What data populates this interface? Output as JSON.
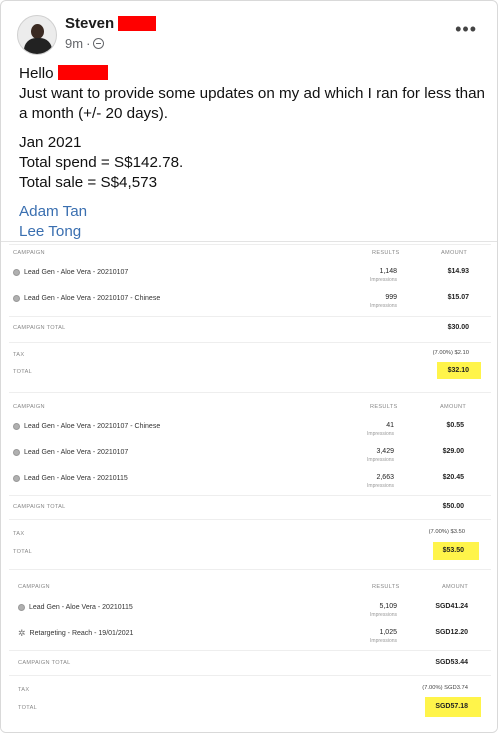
{
  "post": {
    "author": "Steven",
    "time": "9m",
    "visibility_icon": "globe-icon",
    "more_icon": "more-options-icon",
    "more_label": "•••",
    "greeting": "Hello",
    "body_line1": "Just want to provide some updates on my ad which I ran for less than a month (+/- 20 days).",
    "period": "Jan 2021",
    "total_spend": "Total spend = S$142.78.",
    "total_sale": "Total sale = S$4,573",
    "mentions": [
      "Adam Tan",
      "Lee Tong"
    ]
  },
  "screenshot": {
    "tables": [
      {
        "headers": {
          "campaign": "CAMPAIGN",
          "results": "RESULTS",
          "amount": "AMOUNT"
        },
        "rows": [
          {
            "icon": "dot",
            "name": "Lead Gen - Aloe Vera - 20210107",
            "results": "1,148",
            "results_sub": "Impressions",
            "amount": "$14.93"
          },
          {
            "icon": "dot",
            "name": "Lead Gen - Aloe Vera - 20210107 - Chinese",
            "results": "999",
            "results_sub": "Impressions",
            "amount": "$15.07"
          }
        ],
        "campaign_total_label": "CAMPAIGN TOTAL",
        "campaign_total": "$30.00",
        "tax_label": "TAX",
        "tax": "(7.00%) $2.10",
        "total_label": "TOTAL",
        "total": "$32.10"
      },
      {
        "headers": {
          "campaign": "CAMPAIGN",
          "results": "RESULTS",
          "amount": "AMOUNT"
        },
        "rows": [
          {
            "icon": "dot",
            "name": "Lead Gen - Aloe Vera - 20210107 - Chinese",
            "results": "41",
            "results_sub": "Impressions",
            "amount": "$0.55"
          },
          {
            "icon": "dot",
            "name": "Lead Gen - Aloe Vera - 20210107",
            "results": "3,429",
            "results_sub": "Impressions",
            "amount": "$29.00"
          },
          {
            "icon": "dot",
            "name": "Lead Gen - Aloe Vera - 20210115",
            "results": "2,663",
            "results_sub": "Impressions",
            "amount": "$20.45"
          }
        ],
        "campaign_total_label": "CAMPAIGN TOTAL",
        "campaign_total": "$50.00",
        "tax_label": "TAX",
        "tax": "(7.00%) $3.50",
        "total_label": "TOTAL",
        "total": "$53.50"
      },
      {
        "headers": {
          "campaign": "CAMPAIGN",
          "results": "RESULTS",
          "amount": "AMOUNT"
        },
        "rows": [
          {
            "icon": "dot",
            "name": "Lead Gen - Aloe Vera - 20210115",
            "results": "5,109",
            "results_sub": "Impressions",
            "amount": "SGD41.24"
          },
          {
            "icon": "star",
            "name": "Retargeting - Reach - 19/01/2021",
            "results": "1,025",
            "results_sub": "Impressions",
            "amount": "SGD12.20"
          }
        ],
        "campaign_total_label": "CAMPAIGN TOTAL",
        "campaign_total": "SGD53.44",
        "tax_label": "TAX",
        "tax": "(7.00%) SGD3.74",
        "total_label": "TOTAL",
        "total": "SGD57.18"
      }
    ]
  }
}
